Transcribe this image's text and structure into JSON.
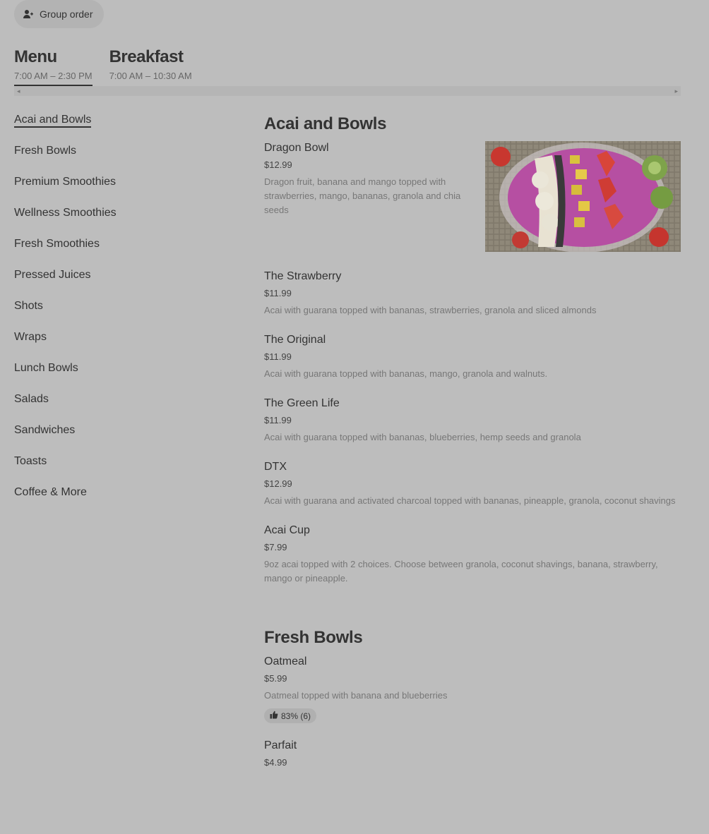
{
  "group_order": {
    "label": "Group order",
    "icon": "person-add-icon"
  },
  "menu_tabs": [
    {
      "title": "Menu",
      "hours": "7:00 AM – 2:30 PM",
      "active": true
    },
    {
      "title": "Breakfast",
      "hours": "7:00 AM – 10:30 AM",
      "active": false
    }
  ],
  "scrollbar": {
    "left_arrow": "◂",
    "right_arrow": "▸"
  },
  "sidebar": {
    "items": [
      {
        "label": "Acai and Bowls",
        "active": true
      },
      {
        "label": "Fresh Bowls"
      },
      {
        "label": "Premium Smoothies"
      },
      {
        "label": "Wellness Smoothies"
      },
      {
        "label": "Fresh Smoothies"
      },
      {
        "label": "Pressed Juices"
      },
      {
        "label": "Shots"
      },
      {
        "label": "Wraps"
      },
      {
        "label": "Lunch Bowls"
      },
      {
        "label": "Salads"
      },
      {
        "label": "Sandwiches"
      },
      {
        "label": "Toasts"
      },
      {
        "label": "Coffee & More"
      }
    ]
  },
  "sections": [
    {
      "title": "Acai and Bowls",
      "items": [
        {
          "name": "Dragon Bowl",
          "price": "$12.99",
          "desc": "Dragon fruit, banana and mango topped with strawberries, mango, bananas, granola and chia seeds",
          "has_image": true
        },
        {
          "name": "The Strawberry",
          "price": "$11.99",
          "desc": "Acai with guarana topped with bananas, strawberries, granola and sliced almonds"
        },
        {
          "name": "The Original",
          "price": "$11.99",
          "desc": "Acai with guarana topped with bananas, mango, granola and walnuts."
        },
        {
          "name": "The Green Life",
          "price": "$11.99",
          "desc": "Acai with guarana topped with bananas, blueberries, hemp seeds and granola"
        },
        {
          "name": "DTX",
          "price": "$12.99",
          "desc": "Acai with guarana and activated charcoal topped with bananas, pineapple, granola, coconut shavings"
        },
        {
          "name": "Acai Cup",
          "price": "$7.99",
          "desc": "9oz acai topped with 2 choices. Choose between granola, coconut shavings, banana, strawberry, mango or pineapple."
        }
      ]
    },
    {
      "title": "Fresh Bowls",
      "items": [
        {
          "name": "Oatmeal",
          "price": "$5.99",
          "desc": "Oatmeal topped with banana and blueberries",
          "rating": "83% (6)",
          "rating_icon": "thumbs-up-icon"
        },
        {
          "name": "Parfait",
          "price": "$4.99",
          "desc": ""
        }
      ]
    }
  ]
}
